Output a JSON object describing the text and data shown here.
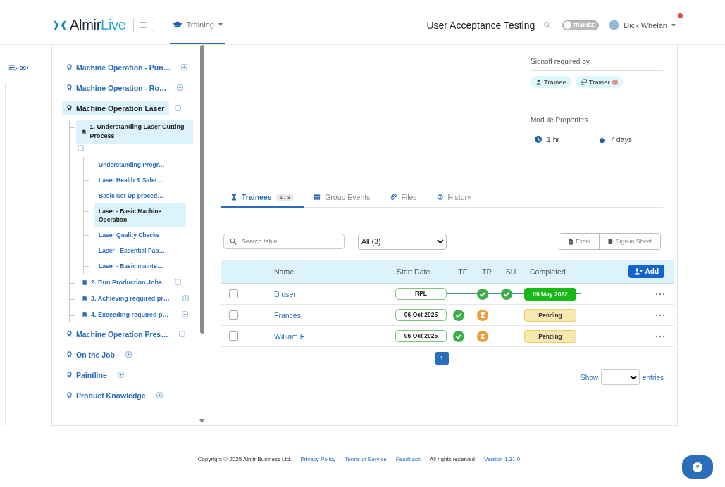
{
  "header": {
    "logo": {
      "primary": "Almir",
      "secondary": "Live"
    },
    "nav": [
      {
        "label": "Training",
        "selected": true
      }
    ],
    "org": "User Acceptance Testing",
    "role_toggle": {
      "label": "TRAINEE",
      "on": false
    },
    "user": {
      "name": "Dick Whelan",
      "notification": true
    }
  },
  "rail": {
    "badge": "99+"
  },
  "tree": [
    {
      "kind": "module",
      "label": "Machine Operation - Pun…",
      "expanded": false,
      "selected": false
    },
    {
      "kind": "module",
      "label": "Machine Operation - Ro…",
      "expanded": false,
      "selected": false
    },
    {
      "kind": "module",
      "label": "Machine Operation Laser",
      "expanded": true,
      "selected": true,
      "children": [
        {
          "kind": "unit",
          "label": "1. Understanding Laser Cutting Process",
          "expanded": true,
          "selected": true,
          "children": [
            {
              "kind": "lesson",
              "label": "Understanding Progr…",
              "selected": false
            },
            {
              "kind": "lesson",
              "label": "Laser Health & Safet…",
              "selected": false
            },
            {
              "kind": "lesson",
              "label": "Basic Set-Up proced…",
              "selected": false
            },
            {
              "kind": "lesson",
              "label": "Laser - Basic Machine Operation",
              "selected": true
            },
            {
              "kind": "lesson",
              "label": "Laser Quality Checks",
              "selected": false
            },
            {
              "kind": "lesson",
              "label": "Laser - Essential Pap…",
              "selected": false
            },
            {
              "kind": "lesson",
              "label": "Laser - Basic mainte…",
              "selected": false
            }
          ]
        },
        {
          "kind": "unit",
          "label": "2. Run Production Jobs",
          "expanded": false,
          "selected": false
        },
        {
          "kind": "unit",
          "label": "3. Achieving required pr…",
          "expanded": false,
          "selected": false
        },
        {
          "kind": "unit",
          "label": "4. Exceeding required p…",
          "expanded": false,
          "selected": false
        }
      ]
    },
    {
      "kind": "module",
      "label": "Machine Operation Pres…",
      "expanded": false,
      "selected": false
    },
    {
      "kind": "module",
      "label": "On the Job",
      "expanded": false,
      "selected": false
    },
    {
      "kind": "module",
      "label": "Paintline",
      "expanded": false,
      "selected": false
    },
    {
      "kind": "module",
      "label": "Product Knowledge",
      "expanded": false,
      "selected": false
    }
  ],
  "signoff": {
    "title": "Signoff required by",
    "chips": [
      {
        "kind": "trainee",
        "label": "Trainee",
        "alert": false
      },
      {
        "kind": "trainer",
        "label": "Trainer",
        "alert": true
      }
    ]
  },
  "properties": {
    "title": "Module Properties",
    "duration": "1 hr",
    "period": "7 days"
  },
  "tabs": [
    {
      "kind": "trainees",
      "label": "Trainees",
      "count": "1 / 3",
      "selected": true
    },
    {
      "kind": "events",
      "label": "Group Events",
      "selected": false
    },
    {
      "kind": "files",
      "label": "Files",
      "selected": false
    },
    {
      "kind": "history",
      "label": "History",
      "selected": false
    }
  ],
  "toolbar": {
    "search_placeholder": "Search table...",
    "filter": "All (3)",
    "buttons": [
      {
        "kind": "excel",
        "label": "Excel"
      },
      {
        "kind": "signin",
        "label": "Sign-in Sheet"
      }
    ]
  },
  "table": {
    "columns": [
      "Name",
      "Start Date",
      "TE",
      "TR",
      "SU",
      "Completed"
    ],
    "add_button": "Add",
    "rows": [
      {
        "checked": false,
        "name": "D user",
        "start": "RPL",
        "te": {
          "signed": false,
          "pending": false
        },
        "tr": {
          "signed": true,
          "pending": false
        },
        "su": {
          "signed": true,
          "pending": false
        },
        "completed": {
          "text": "09 May 2022",
          "done": true
        }
      },
      {
        "checked": false,
        "name": "Frances",
        "start": "06 Oct 2025",
        "te": {
          "signed": true,
          "pending": false
        },
        "tr": {
          "signed": false,
          "pending": true
        },
        "su": {
          "signed": false,
          "pending": false
        },
        "completed": {
          "text": "Pending",
          "done": false
        }
      },
      {
        "checked": false,
        "name": "William F",
        "start": "06 Oct 2025",
        "te": {
          "signed": true,
          "pending": false
        },
        "tr": {
          "signed": false,
          "pending": true
        },
        "su": {
          "signed": false,
          "pending": false
        },
        "completed": {
          "text": "Pending",
          "done": false
        }
      }
    ]
  },
  "pagination": [
    {
      "label": "1",
      "selected": true
    }
  ],
  "page_size": {
    "before": "Show",
    "after": "entries"
  },
  "footer": [
    {
      "kind": "text",
      "text": "Copyright © 2025 Almir Business Ltd."
    },
    {
      "kind": "link",
      "text": "Privacy Policy"
    },
    {
      "kind": "link",
      "text": "Terms of Service"
    },
    {
      "kind": "link",
      "text": "Feedback"
    },
    {
      "kind": "text",
      "text": "All rights reserved"
    },
    {
      "kind": "link",
      "text": "Version 1.31.0"
    }
  ],
  "help_button": "?"
}
